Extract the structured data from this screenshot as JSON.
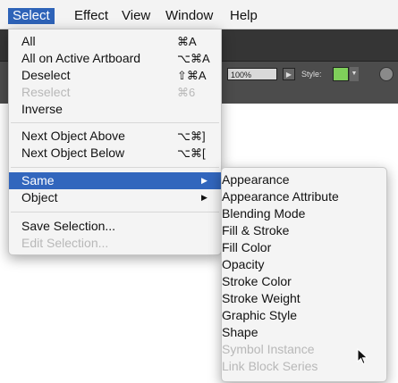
{
  "menubar": {
    "items": [
      {
        "label": "Select",
        "active": true
      },
      {
        "label": "Effect"
      },
      {
        "label": "View"
      },
      {
        "label": "Window"
      },
      {
        "label": "Help"
      }
    ]
  },
  "control_bar": {
    "zoom_value": "100%",
    "style_label": "Style:",
    "style_swatch_color": "#7fcf5a"
  },
  "select_menu": {
    "items": [
      {
        "label": "All",
        "shortcut": "⌘A"
      },
      {
        "label": "All on Active Artboard",
        "shortcut": "⌥⌘A"
      },
      {
        "label": "Deselect",
        "shortcut": "⇧⌘A"
      },
      {
        "label": "Reselect",
        "shortcut": "⌘6",
        "disabled": true
      },
      {
        "label": "Inverse",
        "shortcut": ""
      },
      {
        "label": "Next Object Above",
        "shortcut": "⌥⌘]"
      },
      {
        "label": "Next Object Below",
        "shortcut": "⌥⌘["
      },
      {
        "label": "Same",
        "submenu": true,
        "highlighted": true
      },
      {
        "label": "Object",
        "submenu": true
      },
      {
        "label": "Save Selection...",
        "shortcut": ""
      },
      {
        "label": "Edit Selection...",
        "shortcut": "",
        "disabled": true
      }
    ]
  },
  "same_submenu": {
    "items": [
      {
        "label": "Appearance"
      },
      {
        "label": "Appearance Attribute"
      },
      {
        "label": "Blending Mode"
      },
      {
        "label": "Fill & Stroke"
      },
      {
        "label": "Fill Color"
      },
      {
        "label": "Opacity"
      },
      {
        "label": "Stroke Color"
      },
      {
        "label": "Stroke Weight"
      },
      {
        "label": "Graphic Style"
      },
      {
        "label": "Shape"
      },
      {
        "label": "Symbol Instance",
        "disabled": true
      },
      {
        "label": "Link Block Series",
        "disabled": true
      }
    ]
  },
  "colors": {
    "highlight": "#3266bd",
    "disabled_text": "#b8b8b8"
  },
  "icons": {
    "submenu_arrow": "triangle-right-icon",
    "cursor": "arrow-cursor-icon",
    "globe": "globe-icon"
  }
}
